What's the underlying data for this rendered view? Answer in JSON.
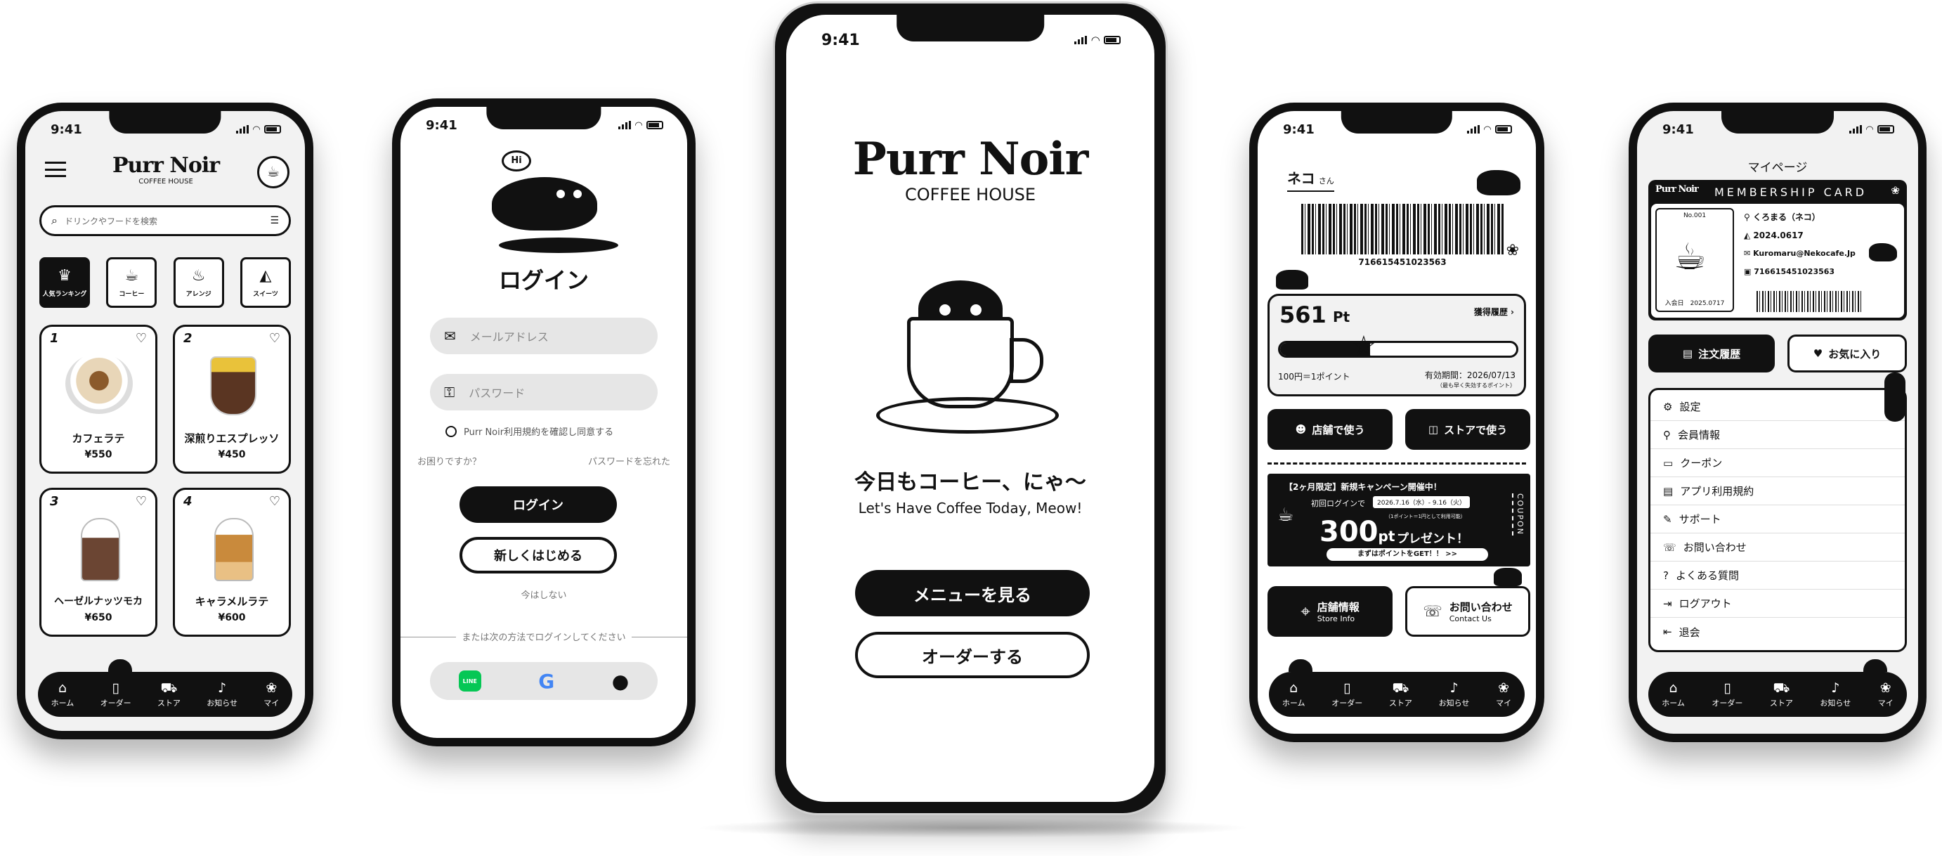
{
  "status": {
    "time": "9:41"
  },
  "brand": {
    "name": "Purr Noir",
    "sub": "COFFEE HOUSE"
  },
  "phone1": {
    "search_placeholder": "ドリンクやフードを検索",
    "categories": [
      "人気ランキング",
      "コーヒー",
      "アレンジ",
      "スイーツ"
    ],
    "products": [
      {
        "rank": "1",
        "name": "カフェラテ",
        "price": "¥550"
      },
      {
        "rank": "2",
        "name": "深煎りエスプレッソ",
        "price": "¥450"
      },
      {
        "rank": "3",
        "name": "ヘーゼルナッツモカ",
        "price": "¥650"
      },
      {
        "rank": "4",
        "name": "キャラメルラテ",
        "price": "¥600"
      }
    ]
  },
  "nav": [
    "ホーム",
    "オーダー",
    "ストア",
    "お知らせ",
    "マイ"
  ],
  "phone2": {
    "bubble": "Hi",
    "title": "ログイン",
    "email_placeholder": "メールアドレス",
    "password_placeholder": "パスワード",
    "terms": "Purr Noir利用規約を確認し同意する",
    "help": "お困りですか？",
    "forgot": "パスワードを忘れた",
    "login": "ログイン",
    "signup": "新しくはじめる",
    "skip": "今はしない",
    "alt": "または次の方法でログインしてください",
    "social": {
      "line": "LINE"
    }
  },
  "phone3": {
    "tagline": "今日もコーヒー、にゃ〜",
    "tagline_en": "Let's Have Coffee Today, Meow!",
    "menu": "メニューを見る",
    "order": "オーダーする"
  },
  "phone4": {
    "name": "ネコ",
    "san": "さん",
    "barcode": "716615451023563",
    "points": "561",
    "pt": "Pt",
    "history": "獲得履歴",
    "rate": "100円＝1ポイント",
    "expiry": "有効期間：2026/07/13",
    "expiry_note": "（最も早く失効するポイント）",
    "use_store": "店舗で使う",
    "use_online": "ストアで使う",
    "coupon": {
      "head": "【2ヶ月限定】新規キャンペーン開催中！",
      "first": "初回ログインで",
      "period": "2026.7.16（水）- 9.16（火）",
      "note": "（1ポイント＝1円として利用可能）",
      "amount": "300",
      "unit": "pt",
      "present": "プレゼント！",
      "cta": "まずはポイントをGET！！ >>",
      "side": "COUPON"
    },
    "store_info": "店舗情報",
    "store_info_en": "Store Info",
    "contact": "お問い合わせ",
    "contact_en": "Contact Us"
  },
  "phone5": {
    "title": "マイページ",
    "card_title": "MEMBERSHIP CARD",
    "no": "No.001",
    "name": "くろまる（ネコ）",
    "birthday": "2024.0617",
    "email": "Kuromaru@Nekocafe.Jp",
    "id": "716615451023563",
    "joined": "入会日　2025.0717",
    "orders": "注文履歴",
    "favorites": "お気に入り",
    "menu": [
      "設定",
      "会員情報",
      "クーポン",
      "アプリ利用規約",
      "サポート",
      "お問い合わせ",
      "よくある質問",
      "ログアウト",
      "退会"
    ]
  }
}
